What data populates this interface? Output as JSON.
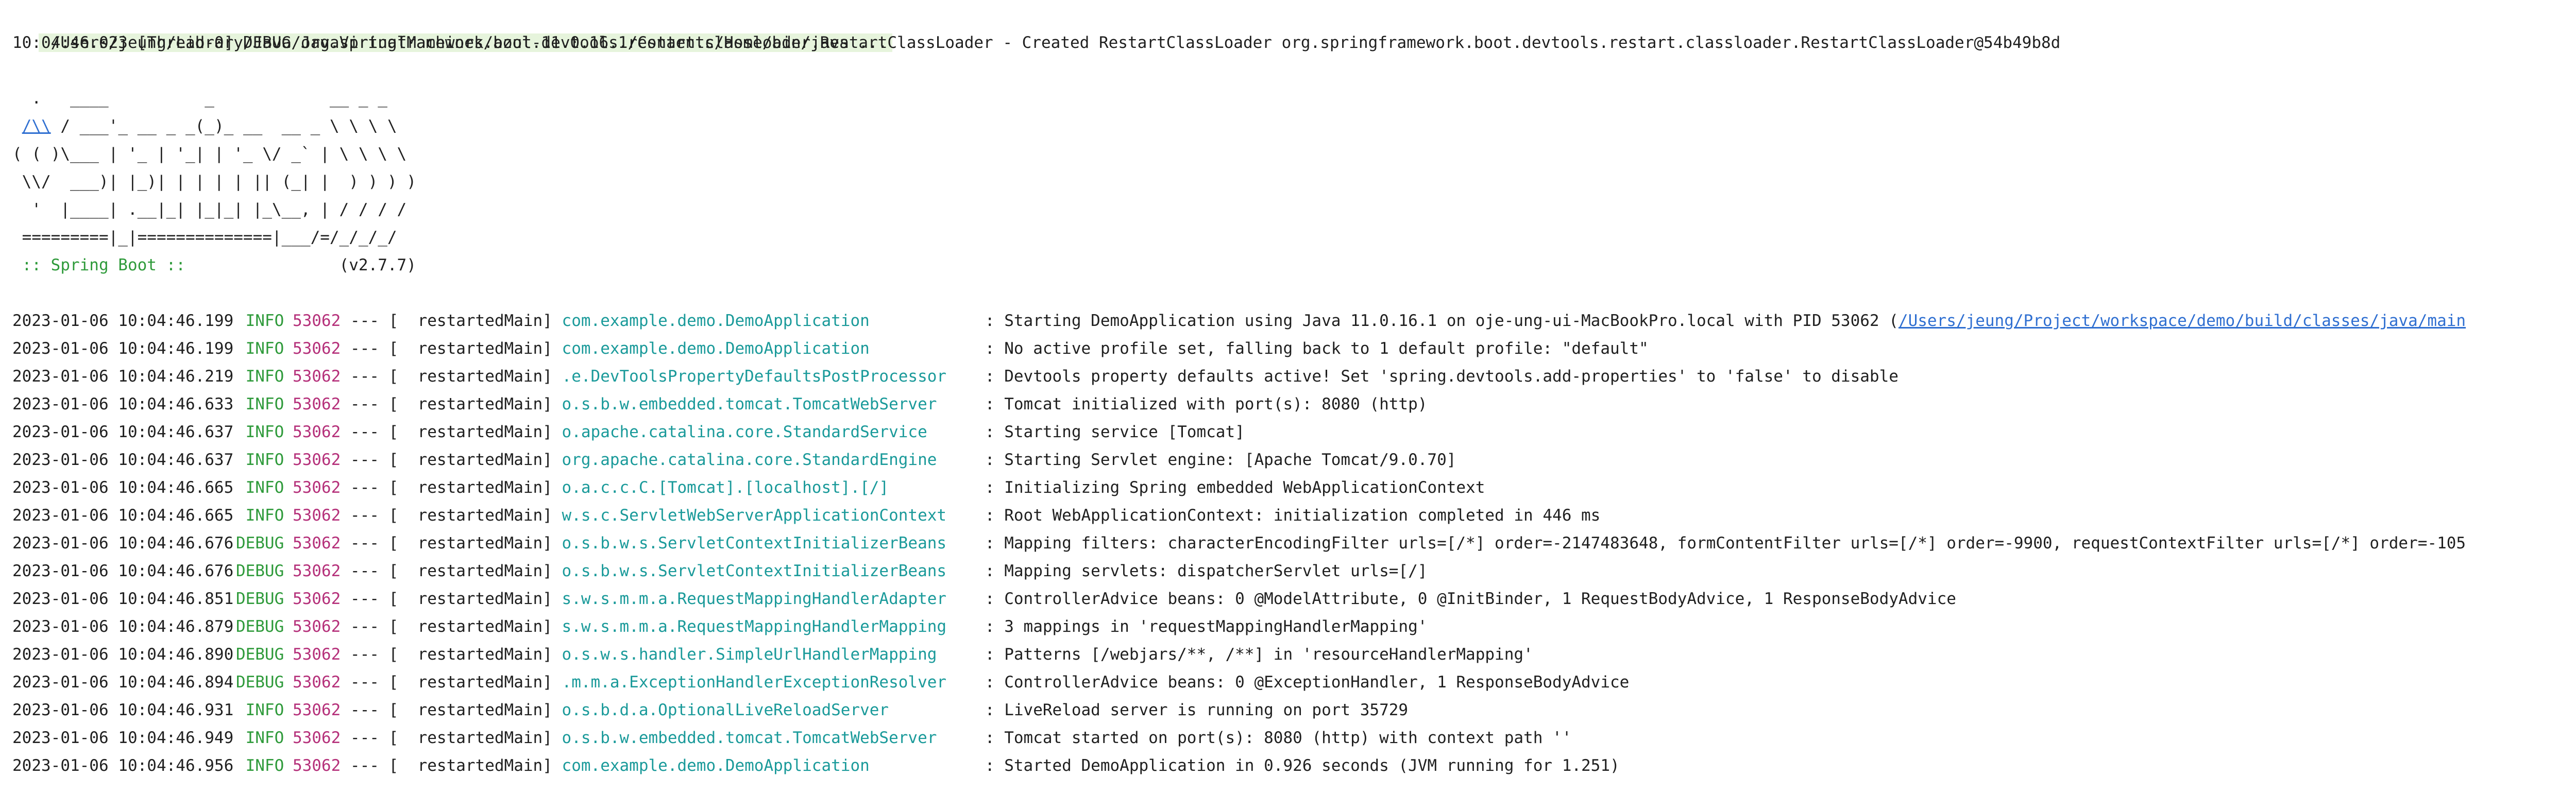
{
  "command_line": "/Users/jeung/Library/Java/JavaVirtualMachines/azul-11.0.16.1/Contents/Home/bin/java ...",
  "restart_line": "10:04:46.023 [Thread-0] DEBUG org.springframework.boot.devtools.restart.classloader.RestartClassLoader - Created RestartClassLoader org.springframework.boot.devtools.restart.classloader.RestartClassLoader@54b49b8d",
  "banner": {
    "line1": "  .   ____          _            __ _ _",
    "line2_link": "/\\\\",
    "line2_rest": " / ___'_ __ _ _(_)_ __  __ _ \\ \\ \\ \\",
    "line3": "( ( )\\___ | '_ | '_| | '_ \\/ _` | \\ \\ \\ \\",
    "line4": " \\\\/  ___)| |_)| | | | | || (_| |  ) ) ) )",
    "line5": "  '  |____| .__|_| |_|_| |_\\__, | / / / /",
    "line6": " =========|_|==============|___/=/_/_/_/",
    "spring_label": " :: Spring Boot :: ",
    "version": "               (v2.7.7)"
  },
  "log_entries": [
    {
      "ts": "2023-01-06 10:04:46.199",
      "level": "INFO",
      "pid": "53062",
      "sep": " --- [",
      "thread": "  restartedMain]",
      "logger": " com.example.demo.DemoApplication",
      "message": ": Starting DemoApplication using Java 11.0.16.1 on oje-ung-ui-MacBookPro.local with PID 53062 (",
      "link": "/Users/jeung/Project/workspace/demo/build/classes/java/main"
    },
    {
      "ts": "2023-01-06 10:04:46.199",
      "level": "INFO",
      "pid": "53062",
      "sep": " --- [",
      "thread": "  restartedMain]",
      "logger": " com.example.demo.DemoApplication",
      "message": ": No active profile set, falling back to 1 default profile: \"default\"",
      "link": ""
    },
    {
      "ts": "2023-01-06 10:04:46.219",
      "level": "INFO",
      "pid": "53062",
      "sep": " --- [",
      "thread": "  restartedMain]",
      "logger": " .e.DevToolsPropertyDefaultsPostProcessor",
      "message": ": Devtools property defaults active! Set 'spring.devtools.add-properties' to 'false' to disable",
      "link": ""
    },
    {
      "ts": "2023-01-06 10:04:46.633",
      "level": "INFO",
      "pid": "53062",
      "sep": " --- [",
      "thread": "  restartedMain]",
      "logger": " o.s.b.w.embedded.tomcat.TomcatWebServer",
      "message": ": Tomcat initialized with port(s): 8080 (http)",
      "link": ""
    },
    {
      "ts": "2023-01-06 10:04:46.637",
      "level": "INFO",
      "pid": "53062",
      "sep": " --- [",
      "thread": "  restartedMain]",
      "logger": " o.apache.catalina.core.StandardService",
      "message": ": Starting service [Tomcat]",
      "link": ""
    },
    {
      "ts": "2023-01-06 10:04:46.637",
      "level": "INFO",
      "pid": "53062",
      "sep": " --- [",
      "thread": "  restartedMain]",
      "logger": " org.apache.catalina.core.StandardEngine",
      "message": ": Starting Servlet engine: [Apache Tomcat/9.0.70]",
      "link": ""
    },
    {
      "ts": "2023-01-06 10:04:46.665",
      "level": "INFO",
      "pid": "53062",
      "sep": " --- [",
      "thread": "  restartedMain]",
      "logger": " o.a.c.c.C.[Tomcat].[localhost].[/]",
      "message": ": Initializing Spring embedded WebApplicationContext",
      "link": ""
    },
    {
      "ts": "2023-01-06 10:04:46.665",
      "level": "INFO",
      "pid": "53062",
      "sep": " --- [",
      "thread": "  restartedMain]",
      "logger": " w.s.c.ServletWebServerApplicationContext",
      "message": ": Root WebApplicationContext: initialization completed in 446 ms",
      "link": ""
    },
    {
      "ts": "2023-01-06 10:04:46.676",
      "level": "DEBUG",
      "pid": "53062",
      "sep": " --- [",
      "thread": "  restartedMain]",
      "logger": " o.s.b.w.s.ServletContextInitializerBeans",
      "message": ": Mapping filters: characterEncodingFilter urls=[/*] order=-2147483648, formContentFilter urls=[/*] order=-9900, requestContextFilter urls=[/*] order=-105",
      "link": ""
    },
    {
      "ts": "2023-01-06 10:04:46.676",
      "level": "DEBUG",
      "pid": "53062",
      "sep": " --- [",
      "thread": "  restartedMain]",
      "logger": " o.s.b.w.s.ServletContextInitializerBeans",
      "message": ": Mapping servlets: dispatcherServlet urls=[/]",
      "link": ""
    },
    {
      "ts": "2023-01-06 10:04:46.851",
      "level": "DEBUG",
      "pid": "53062",
      "sep": " --- [",
      "thread": "  restartedMain]",
      "logger": " s.w.s.m.m.a.RequestMappingHandlerAdapter",
      "message": ": ControllerAdvice beans: 0 @ModelAttribute, 0 @InitBinder, 1 RequestBodyAdvice, 1 ResponseBodyAdvice",
      "link": ""
    },
    {
      "ts": "2023-01-06 10:04:46.879",
      "level": "DEBUG",
      "pid": "53062",
      "sep": " --- [",
      "thread": "  restartedMain]",
      "logger": " s.w.s.m.m.a.RequestMappingHandlerMapping",
      "message": ": 3 mappings in 'requestMappingHandlerMapping'",
      "link": ""
    },
    {
      "ts": "2023-01-06 10:04:46.890",
      "level": "DEBUG",
      "pid": "53062",
      "sep": " --- [",
      "thread": "  restartedMain]",
      "logger": " o.s.w.s.handler.SimpleUrlHandlerMapping",
      "message": ": Patterns [/webjars/**, /**] in 'resourceHandlerMapping'",
      "link": ""
    },
    {
      "ts": "2023-01-06 10:04:46.894",
      "level": "DEBUG",
      "pid": "53062",
      "sep": " --- [",
      "thread": "  restartedMain]",
      "logger": " .m.m.a.ExceptionHandlerExceptionResolver",
      "message": ": ControllerAdvice beans: 0 @ExceptionHandler, 1 ResponseBodyAdvice",
      "link": ""
    },
    {
      "ts": "2023-01-06 10:04:46.931",
      "level": "INFO",
      "pid": "53062",
      "sep": " --- [",
      "thread": "  restartedMain]",
      "logger": " o.s.b.d.a.OptionalLiveReloadServer",
      "message": ": LiveReload server is running on port 35729",
      "link": ""
    },
    {
      "ts": "2023-01-06 10:04:46.949",
      "level": "INFO",
      "pid": "53062",
      "sep": " --- [",
      "thread": "  restartedMain]",
      "logger": " o.s.b.w.embedded.tomcat.TomcatWebServer",
      "message": ": Tomcat started on port(s): 8080 (http) with context path ''",
      "link": ""
    },
    {
      "ts": "2023-01-06 10:04:46.956",
      "level": "INFO",
      "pid": "53062",
      "sep": " --- [",
      "thread": "  restartedMain]",
      "logger": " com.example.demo.DemoApplication",
      "message": ": Started DemoApplication in 0.926 seconds (JVM running for 1.251)",
      "link": ""
    }
  ],
  "colors": {
    "level": "#2e9a3a",
    "pid": "#b5307a",
    "logger": "#1a9a9a",
    "link": "#2f6fd1",
    "command_highlight": "#e6f4dc"
  }
}
